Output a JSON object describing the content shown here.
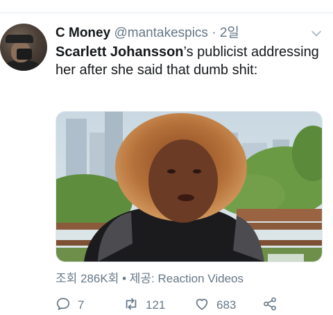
{
  "tweet": {
    "display_name": "C Money",
    "handle": "@mantakespics",
    "separator": " · ",
    "time": "2일",
    "text_mention": "Scarlett Johansson",
    "text_rest": "’s publicist addressing her after she said that dumb shit:",
    "views": "조회 286K회",
    "meta_separator": " • ",
    "source": "제공: Reaction Videos",
    "reply_count": "7",
    "retweet_count": "121",
    "like_count": "683"
  },
  "icons": {
    "more": "chevron-down-icon",
    "reply": "reply-icon",
    "retweet": "retweet-icon",
    "like": "heart-icon",
    "share": "share-icon"
  },
  "colors": {
    "text": "#14171a",
    "muted": "#657786",
    "divider": "#e6ecf0"
  }
}
